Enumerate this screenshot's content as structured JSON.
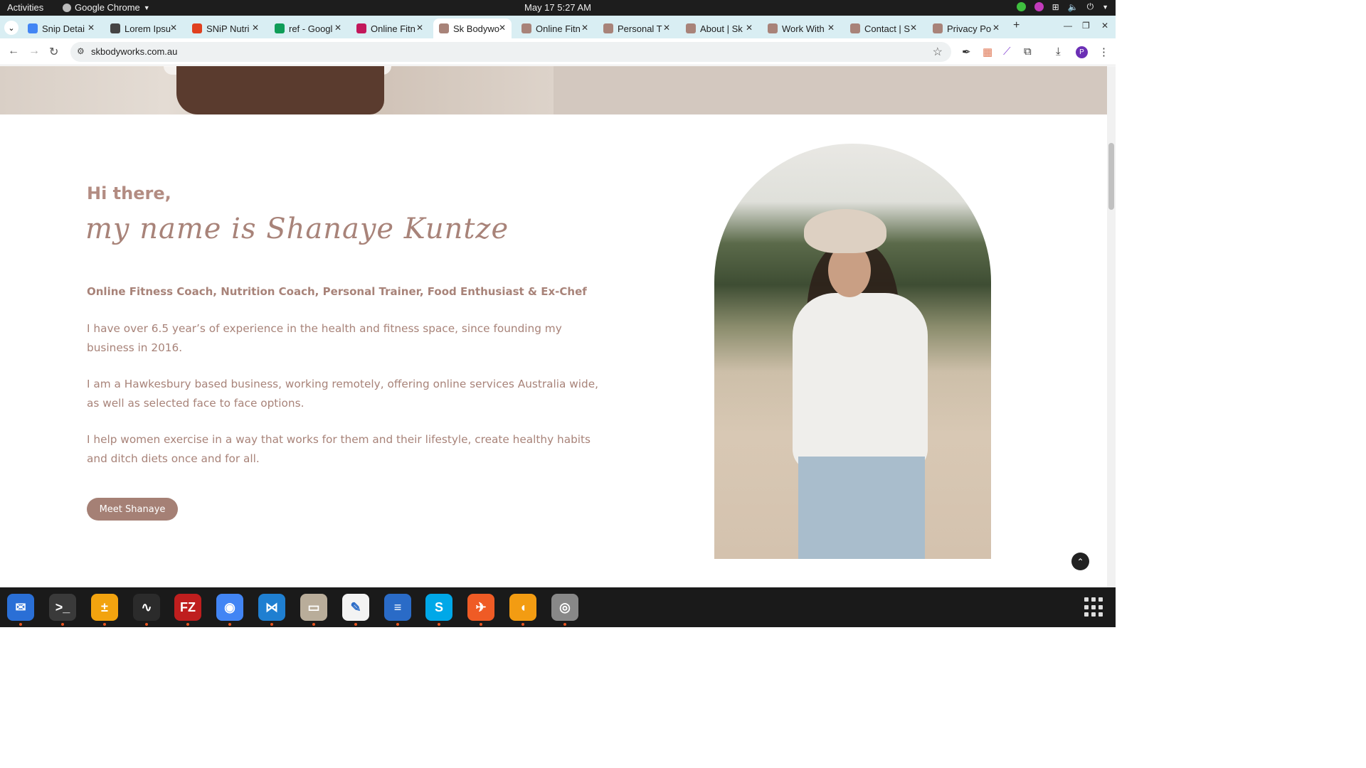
{
  "system": {
    "activities": "Activities",
    "app_name": "Google Chrome",
    "clock": "May 17  5:27 AM"
  },
  "tabs": [
    {
      "title": "Snip Detai",
      "favicon": "docs-icon",
      "color": "#4285f4"
    },
    {
      "title": "Lorem Ipsu",
      "favicon": "lorem-icon",
      "color": "#444444"
    },
    {
      "title": "SNiP Nutri",
      "favicon": "snip-icon",
      "color": "#e0401f"
    },
    {
      "title": "ref - Googl",
      "favicon": "sheets-icon",
      "color": "#0f9d58"
    },
    {
      "title": "Online Fitn",
      "favicon": "flower-icon",
      "color": "#c2185b"
    },
    {
      "title": "Sk Bodywo",
      "favicon": "sk-icon",
      "color": "#a88379",
      "active": true
    },
    {
      "title": "Online Fitn",
      "favicon": "sk-icon",
      "color": "#a88379"
    },
    {
      "title": "Personal T",
      "favicon": "sk-icon",
      "color": "#a88379"
    },
    {
      "title": "About | Sk",
      "favicon": "sk-icon",
      "color": "#a88379"
    },
    {
      "title": "Work With",
      "favicon": "sk-icon",
      "color": "#a88379"
    },
    {
      "title": "Contact | S",
      "favicon": "sk-icon",
      "color": "#a88379"
    },
    {
      "title": "Privacy Po",
      "favicon": "sk-icon",
      "color": "#a88379"
    }
  ],
  "toolbar": {
    "url": "skbodyworks.com.au"
  },
  "profile_initial": "P",
  "content": {
    "greeting": "Hi there,",
    "script_name": "my name is Shanaye Kuntze",
    "roles": "Online Fitness Coach, Nutrition Coach, Personal Trainer, Food Enthusiast & Ex-Chef",
    "paragraph_1": "I have over 6.5 year’s of experience in the health and fitness space, since founding my business in 2016.",
    "paragraph_2": "I am a Hawkesbury based business, working remotely, offering online services Australia wide, as well as selected face to face options.",
    "paragraph_3": "I help women exercise in a way that works for them and their lifestyle, create healthy habits and ditch diets once and for all.",
    "cta_label": "Meet Shanaye"
  },
  "dock": [
    {
      "name": "thunderbird-icon",
      "color": "#2a6fd6",
      "glyph": "✉"
    },
    {
      "name": "terminal-icon",
      "color": "#3a3a3a",
      "glyph": ">_"
    },
    {
      "name": "calculator-icon",
      "color": "#f2a30f",
      "glyph": "±"
    },
    {
      "name": "system-monitor-icon",
      "color": "#2b2b2b",
      "glyph": "∿"
    },
    {
      "name": "filezilla-icon",
      "color": "#bf1e1e",
      "glyph": "FZ"
    },
    {
      "name": "chrome-icon",
      "color": "#4285f4",
      "glyph": "◉"
    },
    {
      "name": "vscode-icon",
      "color": "#1f7fd1",
      "glyph": "⋈"
    },
    {
      "name": "files-icon",
      "color": "#b9ad9a",
      "glyph": "▭"
    },
    {
      "name": "text-editor-icon",
      "color": "#f3f3f3",
      "glyph": "✎"
    },
    {
      "name": "libreoffice-writer-icon",
      "color": "#2a6bc7",
      "glyph": "≡"
    },
    {
      "name": "skype-icon",
      "color": "#00a8e8",
      "glyph": "S"
    },
    {
      "name": "postman-icon",
      "color": "#ef5b25",
      "glyph": "✈"
    },
    {
      "name": "blaze-icon",
      "color": "#f39c12",
      "glyph": "◖"
    },
    {
      "name": "disk-icon",
      "color": "#888888",
      "glyph": "◎"
    }
  ]
}
